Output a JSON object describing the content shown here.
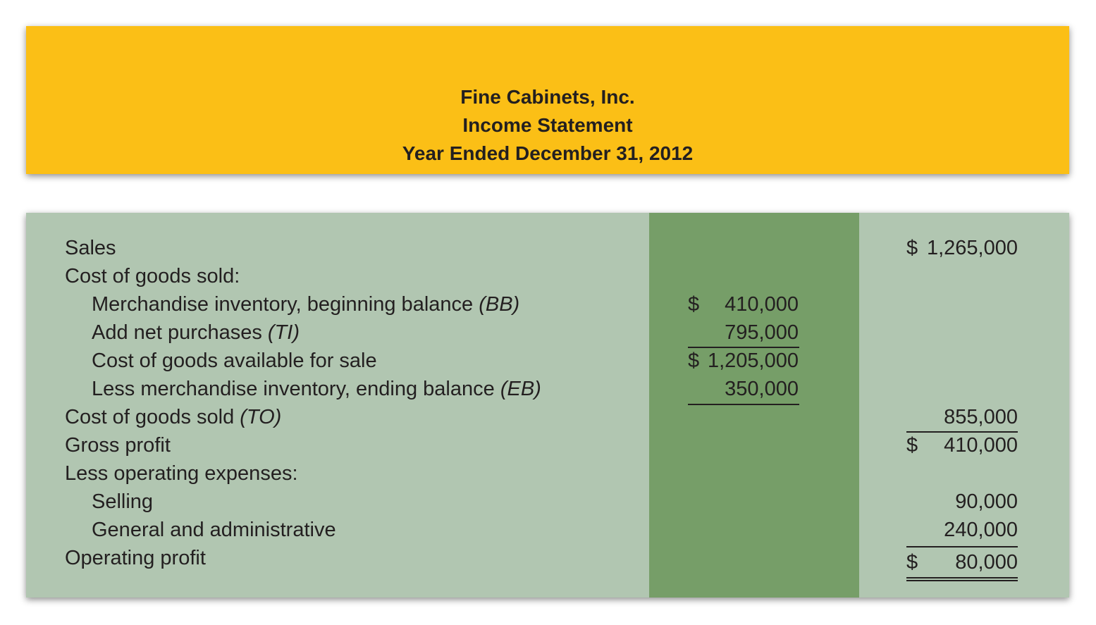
{
  "header": {
    "company": "Fine Cabinets, Inc.",
    "statement": "Income Statement",
    "period": "Year Ended December 31, 2012"
  },
  "rows": {
    "sales": {
      "label": "Sales",
      "dollar": "$",
      "amount": "1,265,000"
    },
    "cogs_heading": {
      "label": "Cost of goods sold:"
    },
    "beginning": {
      "label": "Merchandise inventory, beginning balance ",
      "tag": "(BB)",
      "dollar": "$",
      "amount": "410,000"
    },
    "purchases": {
      "label": "Add net purchases ",
      "tag": "(TI)",
      "amount": "795,000"
    },
    "available": {
      "label": "Cost of goods available for sale",
      "dollar": "$",
      "amount": "1,205,000"
    },
    "ending": {
      "label": "Less merchandise inventory, ending balance ",
      "tag": "(EB)",
      "amount": "350,000"
    },
    "cogs": {
      "label": "Cost of goods sold ",
      "tag": "(TO)",
      "amount": "855,000"
    },
    "gross_profit": {
      "label": "Gross profit",
      "dollar": "$",
      "amount": "410,000"
    },
    "opex_heading": {
      "label": "Less operating expenses:"
    },
    "selling": {
      "label": "Selling",
      "amount": "90,000"
    },
    "general_admin": {
      "label": "General and administrative",
      "amount": "240,000"
    },
    "operating_profit": {
      "label": "Operating profit",
      "dollar": "$",
      "amount": "80,000"
    }
  }
}
